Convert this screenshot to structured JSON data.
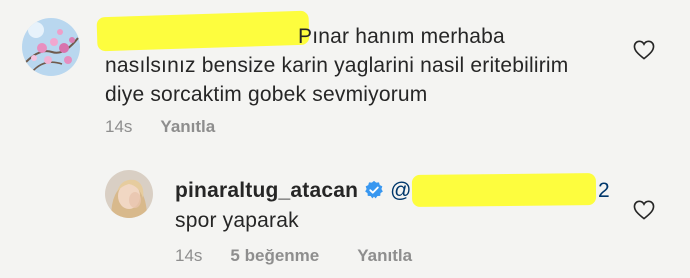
{
  "comment_1": {
    "avatar_icon": "flowers-avatar",
    "text_line_1": "Pınar hanım merhaba",
    "text_line_2": "nasılsınız bensize karin yaglarini nasil eritebilirim",
    "text_line_3": "diye sorcaktim gobek sevmiyorum",
    "time": "14s",
    "reply_label": "Yanıtla",
    "heart_icon": "heart-outline-icon"
  },
  "comment_2": {
    "avatar_icon": "user-photo-avatar",
    "username": "pinaraltug_atacan",
    "verified_icon": "verified-badge-icon",
    "mention_prefix": "@",
    "mention_suffix": "2",
    "text": "spor yaparak",
    "time": "14s",
    "likes": "5 beğenme",
    "reply_label": "Yanıtla",
    "heart_icon": "heart-outline-icon"
  },
  "colors": {
    "background": "#f4f4f2",
    "redaction": "#fdfd38",
    "verified": "#3897f0",
    "meta": "#8e8e8e"
  }
}
